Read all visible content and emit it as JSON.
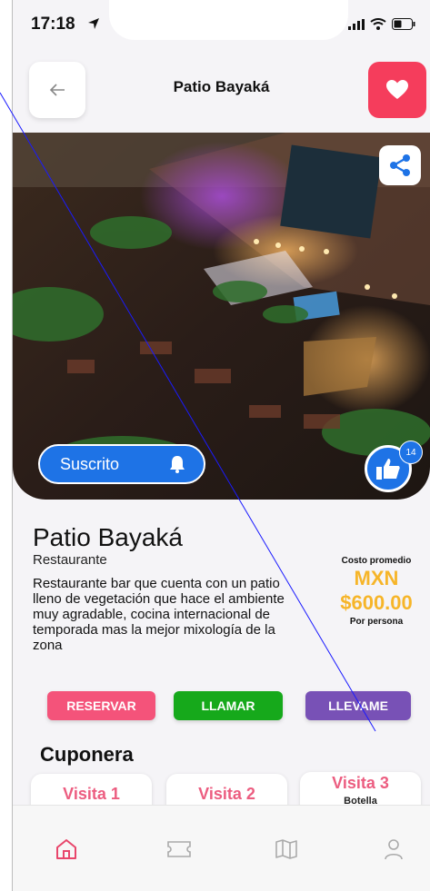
{
  "status_bar": {
    "time": "17:18"
  },
  "header": {
    "title": "Patio Bayaká"
  },
  "hero": {
    "subscribe_label": "Suscrito",
    "like_count": "14"
  },
  "restaurant": {
    "name": "Patio Bayaká",
    "type": "Restaurante",
    "description": "Restaurante bar que cuenta con un patio lleno de vegetación que hace el ambiente muy agradable, cocina internacional de temporada mas la mejor mixología de la zona"
  },
  "price": {
    "label": "Costo promedio",
    "currency": "MXN",
    "value": "$600.00",
    "unit": "Por persona"
  },
  "actions": {
    "reservar": "RESERVAR",
    "llamar": "LLAMAR",
    "llevame": "LLEVAME"
  },
  "coupons": {
    "title": "Cuponera",
    "items": [
      {
        "label": "Visita 1"
      },
      {
        "label": "Visita 2"
      },
      {
        "label": "Visita 3",
        "sub": "Botella"
      }
    ]
  },
  "colors": {
    "accent": "#f53d5c",
    "blue": "#1e73e6",
    "green": "#16a91b",
    "purple": "#7851b6",
    "gold": "#f6b529"
  },
  "tabbar": {
    "icons": [
      "home-icon",
      "ticket-icon",
      "map-icon",
      "user-icon"
    ]
  }
}
